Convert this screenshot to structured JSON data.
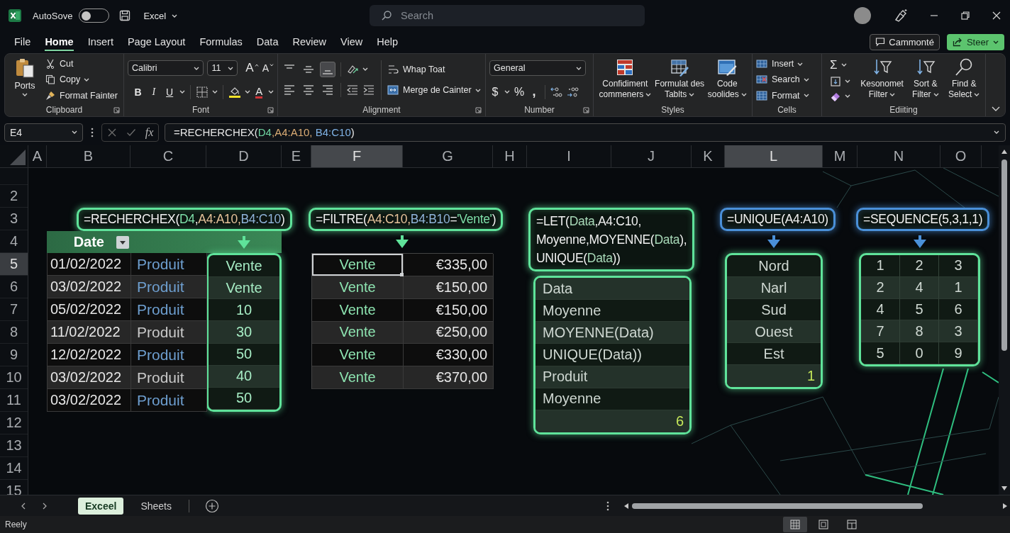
{
  "title_bar": {
    "autosave_label": "AutoSove",
    "autosave_on": false,
    "file_name": "Excel",
    "search": {
      "placeholder": "Search"
    }
  },
  "menu_tabs": [
    {
      "label": "File",
      "selected": false
    },
    {
      "label": "Home",
      "selected": true
    },
    {
      "label": "Insert",
      "selected": false
    },
    {
      "label": "Page Layout",
      "selected": false
    },
    {
      "label": "Formulas",
      "selected": false
    },
    {
      "label": "Data",
      "selected": false
    },
    {
      "label": "Review",
      "selected": false
    },
    {
      "label": "View",
      "selected": false
    },
    {
      "label": "Help",
      "selected": false
    }
  ],
  "header_buttons": {
    "comments": "Cammonté",
    "share": "Steer"
  },
  "ribbon": {
    "clipboard": {
      "label": "Clipboard",
      "paste": "Ports",
      "cut": "Cut",
      "copy": "Copy",
      "format_painter": "Format Fainter"
    },
    "font": {
      "label": "Font",
      "font_name": "Calibri",
      "font_size": "11",
      "grow": "A",
      "shrink": "A",
      "bold": "B",
      "italic": "I",
      "underline": "U",
      "font_color": "A"
    },
    "alignment": {
      "label": "Alignment",
      "buttons": [
        {
          "kind": "top",
          "selected": false
        },
        {
          "kind": "middle",
          "selected": false
        },
        {
          "kind": "bottom",
          "selected": true
        },
        {
          "kind": "left",
          "selected": false
        },
        {
          "kind": "center",
          "selected": false
        },
        {
          "kind": "right",
          "selected": false
        }
      ],
      "wrap_text": "Whap Toat",
      "merge": "Merge de Cainter"
    },
    "number": {
      "label": "Number",
      "format": "General",
      "currency": "$",
      "percent": "%",
      "comma": ","
    },
    "styles": {
      "label": "Styles",
      "buttons": [
        {
          "kind": "conditional",
          "label": "Confidiment commeners"
        },
        {
          "kind": "table",
          "label": "Formulat des Tablts"
        },
        {
          "kind": "cell",
          "label": "Code soolides"
        }
      ]
    },
    "cells": {
      "label": "Cells",
      "buttons": [
        {
          "kind": "insert",
          "label": "Insert"
        },
        {
          "kind": "delete",
          "label": "Search"
        },
        {
          "kind": "format",
          "label": "Format"
        }
      ]
    },
    "editing": {
      "label": "Ediiting",
      "autosum": "Σ",
      "buttons": [
        {
          "kind": "sort",
          "label": "Kesonomet Filter"
        },
        {
          "kind": "filter",
          "label": "Sort & Filter"
        },
        {
          "kind": "find",
          "label": "Find & Select"
        }
      ]
    }
  },
  "formula_bar": {
    "cell_ref": "E4",
    "function_label": "fx",
    "formula": [
      {
        "text": "=RECHERCHEX(",
        "color": "#e6e6e6"
      },
      {
        "text": "D4",
        "color": "#6fd3a0"
      },
      {
        "text": ",A4:A10, ",
        "color": "#d9ab74"
      },
      {
        "text": "B4:C10",
        "color": "#7fb2e5"
      },
      {
        "text": ")",
        "color": "#e6e6e6"
      }
    ]
  },
  "sheet": {
    "columns": [
      {
        "label": "A",
        "selected": false
      },
      {
        "label": "B",
        "selected": false
      },
      {
        "label": "C",
        "selected": false
      },
      {
        "label": "D",
        "selected": false
      },
      {
        "label": "E",
        "selected": false
      },
      {
        "label": "F",
        "selected": true
      },
      {
        "label": "G",
        "selected": false
      },
      {
        "label": "H",
        "selected": false
      },
      {
        "label": "I",
        "selected": false
      },
      {
        "label": "J",
        "selected": false
      },
      {
        "label": "K",
        "selected": false
      },
      {
        "label": "L",
        "selected": true
      },
      {
        "label": "M",
        "selected": false
      },
      {
        "label": "N",
        "selected": false
      },
      {
        "label": "O",
        "selected": false
      }
    ],
    "rows": [
      {
        "label": "2",
        "selected": false
      },
      {
        "label": "3",
        "selected": false
      },
      {
        "label": "4",
        "selected": false
      },
      {
        "label": "5",
        "selected": true
      },
      {
        "label": "6",
        "selected": false
      },
      {
        "label": "7",
        "selected": false
      },
      {
        "label": "8",
        "selected": false
      },
      {
        "label": "9",
        "selected": false
      },
      {
        "label": "10",
        "selected": false
      },
      {
        "label": "11",
        "selected": false
      },
      {
        "label": "12",
        "selected": false
      },
      {
        "label": "13",
        "selected": false
      },
      {
        "label": "14",
        "selected": false
      },
      {
        "label": "15",
        "selected": false
      }
    ],
    "blocks": [
      {
        "kind": "lookup",
        "color": "#5fe39a",
        "formula": [
          {
            "text": "=RECHERCHEX(",
            "color": "#f0f0f0"
          },
          {
            "text": "D4",
            "color": "#7ddfa8"
          },
          {
            "text": ",",
            "color": "#f0f0f0"
          },
          {
            "text": "A4:A10,",
            "color": "#e5c39a"
          },
          {
            "text": "B4:C10",
            "color": "#8fb4d9"
          },
          {
            "text": ")",
            "color": "#f0f0f0"
          }
        ],
        "header": "Date",
        "rows": [
          {
            "date": "01/02/2022",
            "product": {
              "text": "Produit",
              "color": "#6e9fd0"
            },
            "result": "Vente"
          },
          {
            "date": "03/02/2022",
            "product": {
              "text": "Produit",
              "color": "#6e9fd0"
            },
            "result": "Vente"
          },
          {
            "date": "05/02/2022",
            "product": {
              "text": "Produit",
              "color": "#6e9fd0"
            },
            "result": "10"
          },
          {
            "date": "11/02/2022",
            "product": {
              "text": "Produit",
              "color": "#c9c9c9"
            },
            "result": "30"
          },
          {
            "date": "12/02/2022",
            "product": {
              "text": "Produit",
              "color": "#6e9fd0"
            },
            "result": "50"
          },
          {
            "date": "03/02/2022",
            "product": {
              "text": "Produit",
              "color": "#c9c9c9"
            },
            "result": "40"
          },
          {
            "date": "03/02/2022",
            "product": {
              "text": "Produit",
              "color": "#6e9fd0"
            },
            "result": "50"
          }
        ]
      },
      {
        "kind": "filter",
        "color": "#5fe39a",
        "formula": [
          {
            "text": "=FILTRE(",
            "color": "#f0f0f0"
          },
          {
            "text": "A4:C10,",
            "color": "#e5c39a"
          },
          {
            "text": "B4:B10",
            "color": "#8fb4d9"
          },
          {
            "text": "=",
            "color": "#f0f0f0"
          },
          {
            "text": "'Vente'",
            "color": "#7ddfa8"
          },
          {
            "text": ")",
            "color": "#f0f0f0"
          }
        ],
        "rows": [
          {
            "type": "Vente",
            "amount": "€335,00",
            "selected": true
          },
          {
            "type": "Vente",
            "amount": "€150,00",
            "selected": false
          },
          {
            "type": "Vente",
            "amount": "€150,00",
            "selected": false
          },
          {
            "type": "Vente",
            "amount": "€250,00",
            "selected": false
          },
          {
            "type": "Vente",
            "amount": "€330,00",
            "selected": false
          },
          {
            "type": "Vente",
            "amount": "€370,00",
            "selected": false
          }
        ]
      },
      {
        "kind": "let",
        "color": "#5fe39a",
        "formula_lines": [
          [
            {
              "text": "=LET(",
              "color": "#f0f0f0"
            },
            {
              "text": "Data",
              "color": "#a8d9b8"
            },
            {
              "text": ",A4:C10,",
              "color": "#f0f0f0"
            }
          ],
          [
            {
              "text": "Moyenne,MOYENNE(",
              "color": "#f0f0f0"
            },
            {
              "text": "Data",
              "color": "#a8d9b8"
            },
            {
              "text": "),",
              "color": "#f0f0f0"
            }
          ],
          [
            {
              "text": "UNIQUE(",
              "color": "#f0f0f0"
            },
            {
              "text": "Data",
              "color": "#a8d9b8"
            },
            {
              "text": "))",
              "color": "#f0f0f0"
            }
          ]
        ],
        "rows": [
          "Data",
          "Moyenne",
          "MOYENNE(Data)",
          "UNIQUE(Data))",
          "Produit",
          "Moyenne"
        ],
        "total": "6"
      },
      {
        "kind": "unique",
        "color": "#4a90d9",
        "formula": [
          {
            "text": "=UNIQUE(A4:A10)",
            "color": "#f0f0f0"
          }
        ],
        "values": [
          "Nord",
          "Narl",
          "Sud",
          "Ouest",
          "Est"
        ],
        "total": "1"
      },
      {
        "kind": "sequence",
        "color": "#4a90d9",
        "formula": [
          {
            "text": "=SEQUENCE(5,3,1,1)",
            "color": "#f0f0f0"
          }
        ],
        "rows": [
          [
            "1",
            "2",
            "3"
          ],
          [
            "2",
            "4",
            "1"
          ],
          [
            "4",
            "5",
            "6"
          ],
          [
            "7",
            "8",
            "3"
          ],
          [
            "5",
            "0",
            "9"
          ]
        ]
      }
    ]
  },
  "sheet_tabs": [
    {
      "label": "Exceel",
      "selected": true
    },
    {
      "label": "Sheets",
      "selected": false
    }
  ],
  "status_bar": {
    "text": "Reely",
    "views": [
      {
        "kind": "normal",
        "selected": true
      },
      {
        "kind": "page_layout",
        "selected": false
      },
      {
        "kind": "page_break",
        "selected": false
      }
    ]
  }
}
